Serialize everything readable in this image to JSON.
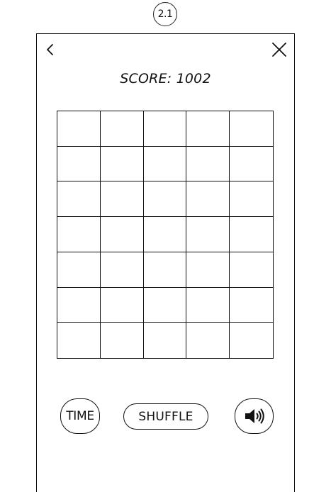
{
  "screen": {
    "label": "2.1"
  },
  "header": {
    "back_icon": "chevron-left-icon",
    "close_icon": "close-icon"
  },
  "score": {
    "text": "SCORE: 1002"
  },
  "board": {
    "rows": 7,
    "columns": 5
  },
  "controls": {
    "time_label": "TIME",
    "shuffle_label": "SHUFFLE",
    "sound_icon": "speaker-volume-icon"
  },
  "colors": {
    "stroke": "#111111",
    "background": "#ffffff"
  }
}
